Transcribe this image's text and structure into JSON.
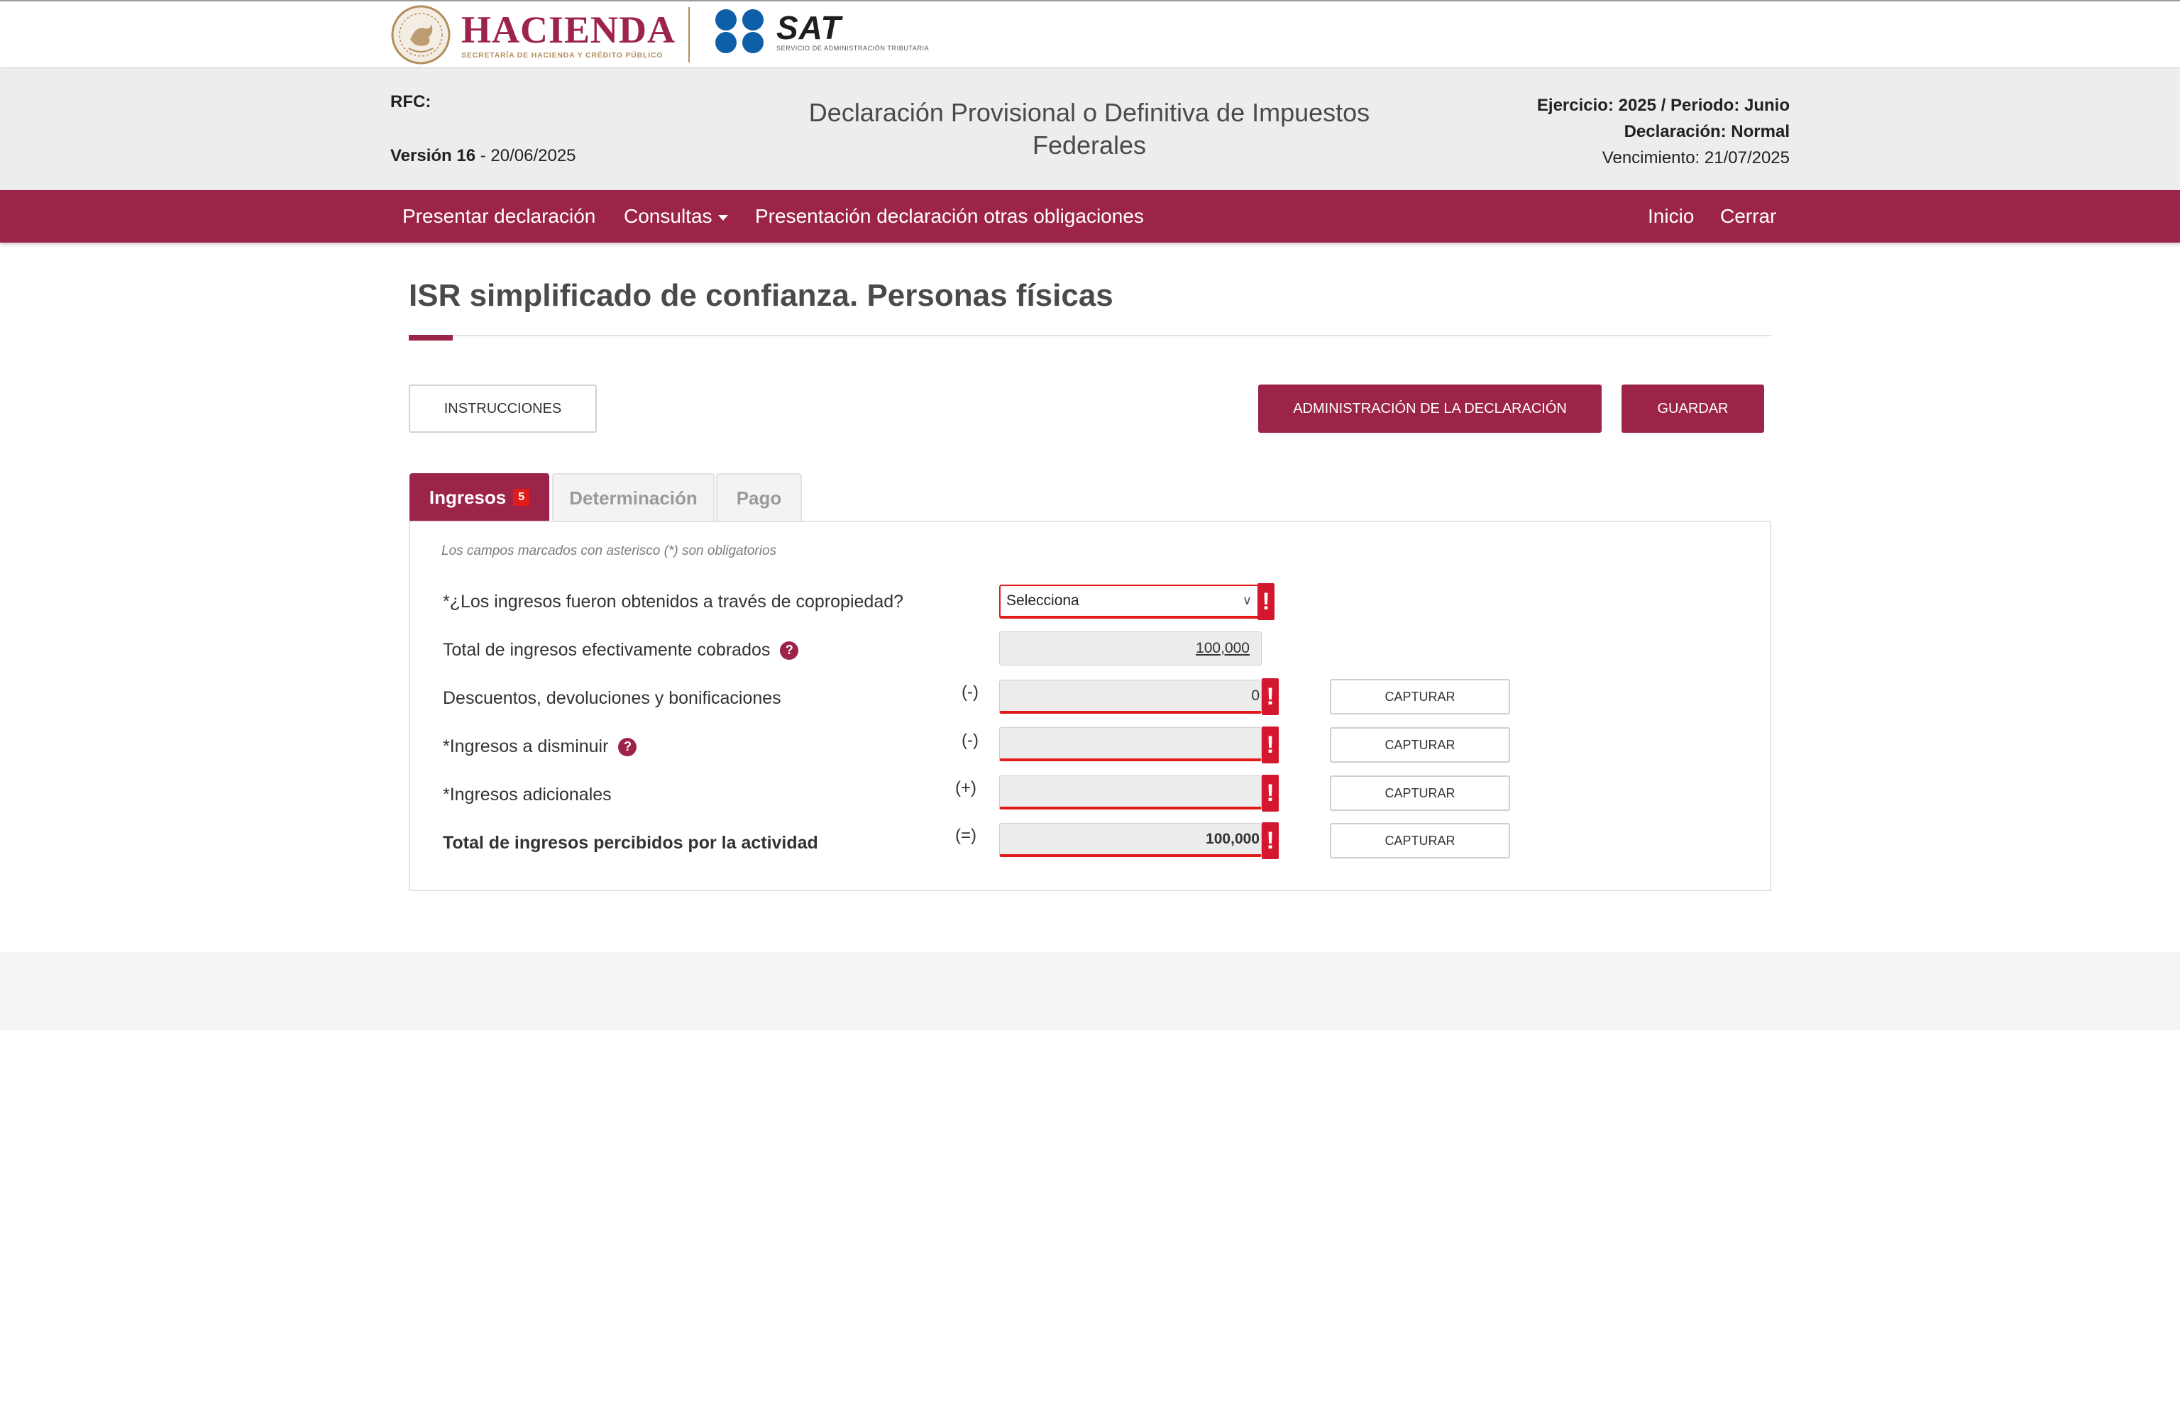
{
  "header": {
    "hacienda_word": "HACIENDA",
    "hacienda_sub": "SECRETARÍA DE HACIENDA Y CRÉDITO PÚBLICO",
    "sat_word": "SAT",
    "sat_sub": "SERVICIO DE ADMINISTRACIÓN TRIBUTARIA"
  },
  "info": {
    "rfc_label": "RFC:",
    "version_label": "Versión 16",
    "version_date": " - 20/06/2025",
    "title": "Declaración Provisional o Definitiva de Impuestos Federales",
    "ejercicio": "Ejercicio: 2025 / Periodo: Junio",
    "declaracion": "Declaración: Normal",
    "vencimiento": "Vencimiento: 21/07/2025"
  },
  "nav": {
    "presentar": "Presentar declaración",
    "consultas": "Consultas",
    "otras": "Presentación declaración otras obligaciones",
    "inicio": "Inicio",
    "cerrar": "Cerrar"
  },
  "page": {
    "title": "ISR simplificado de confianza. Personas físicas"
  },
  "buttons": {
    "instrucciones": "INSTRUCCIONES",
    "administracion": "ADMINISTRACIÓN DE LA DECLARACIÓN",
    "guardar": "GUARDAR",
    "capturar": "CAPTURAR"
  },
  "tabs": {
    "ingresos": "Ingresos",
    "ingresos_badge": "5",
    "determinacion": "Determinación",
    "pago": "Pago"
  },
  "form": {
    "hint": "Los campos marcados con asterisco (*) son obligatorios",
    "copropiedad_label": "*¿Los ingresos fueron obtenidos a través de copropiedad?",
    "copropiedad_value": "Selecciona",
    "total_cobrados_label": "Total de ingresos efectivamente cobrados",
    "total_cobrados_value": "100,000",
    "descuentos_label": "Descuentos, devoluciones y bonificaciones",
    "descuentos_sign": "(-)",
    "descuentos_value": "0",
    "disminuir_label": "*Ingresos a disminuir",
    "disminuir_sign": "(-)",
    "disminuir_value": "",
    "adicionales_label": "*Ingresos adicionales",
    "adicionales_sign": "(+)",
    "adicionales_value": "",
    "total_percibidos_label": "Total de ingresos percibidos por la actividad",
    "total_percibidos_sign": "(=)",
    "total_percibidos_value": "100,000",
    "error_glyph": "!",
    "help_glyph": "?"
  },
  "colors": {
    "brand": "#9d2449",
    "gold": "#b38e5d",
    "error": "#e31a1a"
  }
}
